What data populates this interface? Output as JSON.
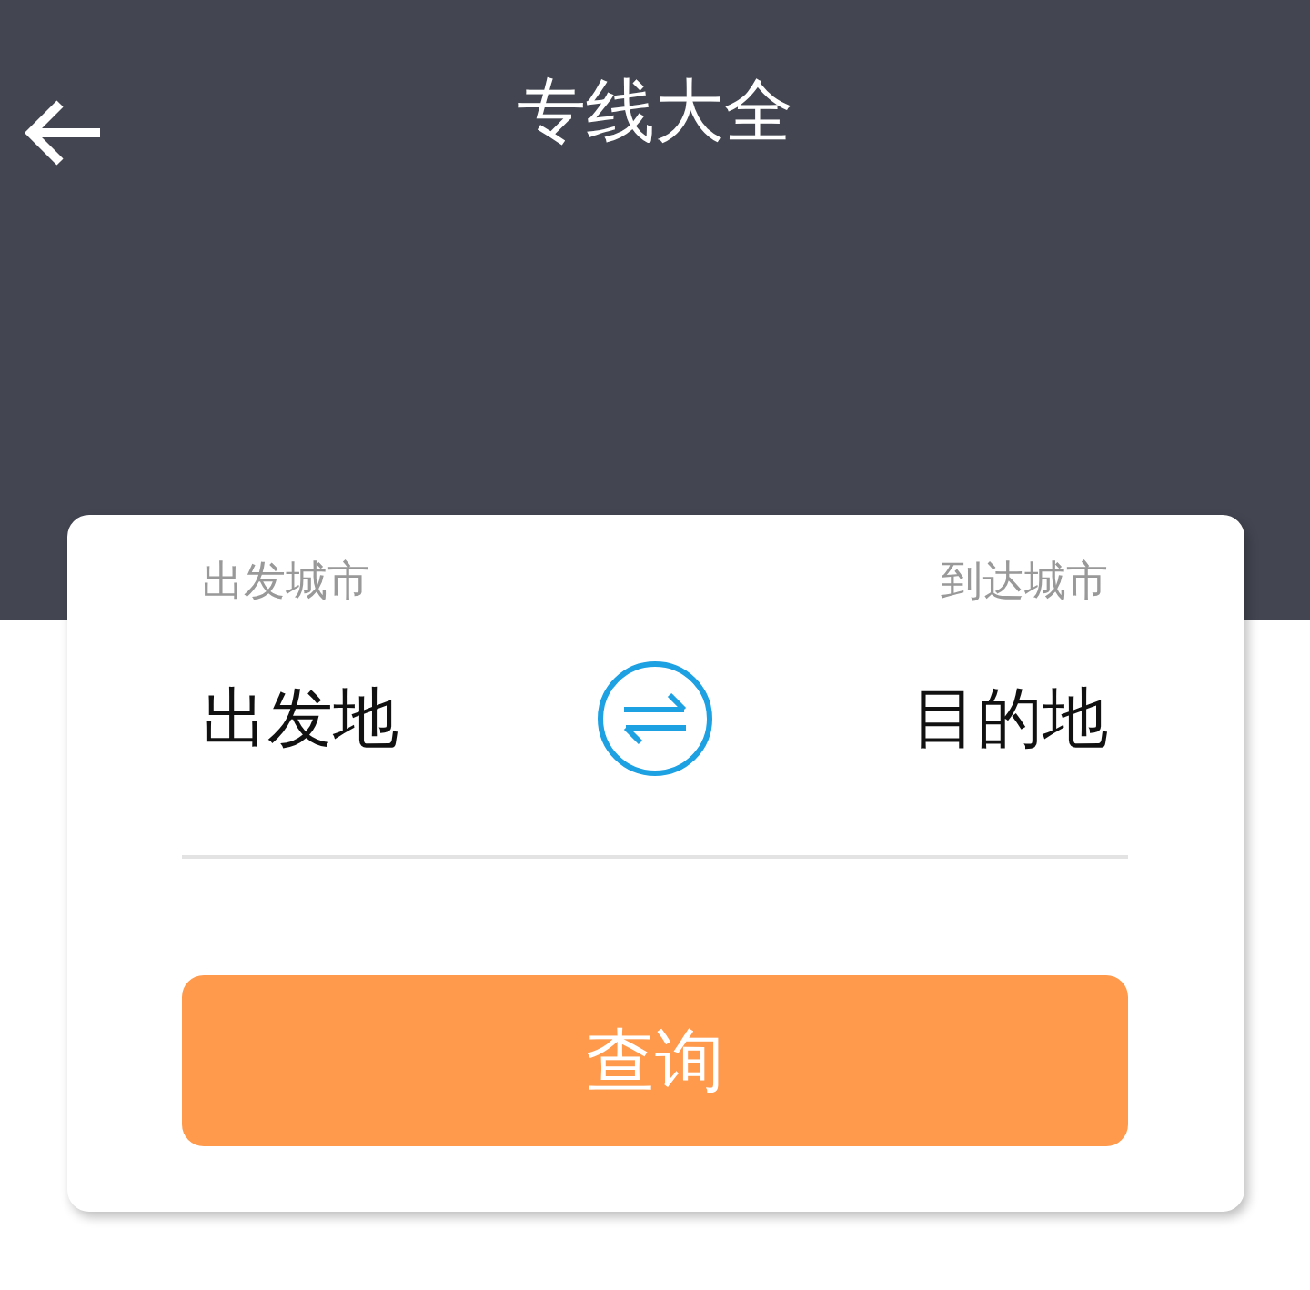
{
  "header": {
    "title": "专线大全"
  },
  "route": {
    "from_label": "出发城市",
    "to_label": "到达城市",
    "from_value": "出发地",
    "to_value": "目的地"
  },
  "search_button": "查询"
}
